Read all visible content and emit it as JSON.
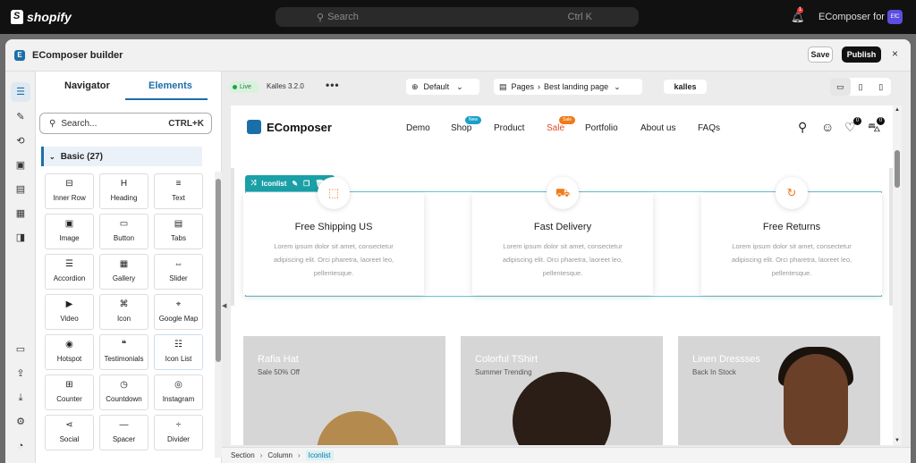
{
  "shopify": {
    "brand": "shopify",
    "search_placeholder": "Search",
    "search_shortcut": "Ctrl K",
    "notification_count": "1",
    "store_name": "EComposer for CS",
    "avatar_initials": "EfC"
  },
  "builder": {
    "title": "EComposer builder",
    "save_label": "Save",
    "publish_label": "Publish",
    "close_symbol": "×"
  },
  "rail_icons": [
    "layers-icon",
    "brush-icon",
    "history-icon",
    "clipboard-icon",
    "box-icon",
    "apps-icon",
    "page-icon",
    "folder-icon",
    "upload-icon",
    "download-icon",
    "settings-icon",
    "chat-icon"
  ],
  "panel": {
    "tab_navigator": "Navigator",
    "tab_elements": "Elements",
    "search_placeholder": "Search...",
    "search_shortcut": "CTRL+K",
    "group_title": "Basic (27)",
    "elements": [
      {
        "label": "Inner Row",
        "icon": "⊟"
      },
      {
        "label": "Heading",
        "icon": "H"
      },
      {
        "label": "Text",
        "icon": "≡"
      },
      {
        "label": "Image",
        "icon": "▣"
      },
      {
        "label": "Button",
        "icon": "▭"
      },
      {
        "label": "Tabs",
        "icon": "▤"
      },
      {
        "label": "Accordion",
        "icon": "☰"
      },
      {
        "label": "Gallery",
        "icon": "▦"
      },
      {
        "label": "Slider",
        "icon": "⇔"
      },
      {
        "label": "Video",
        "icon": "▶"
      },
      {
        "label": "Icon",
        "icon": "⌘"
      },
      {
        "label": "Google Map",
        "icon": "⌖"
      },
      {
        "label": "Hotspot",
        "icon": "◉"
      },
      {
        "label": "Testimonials",
        "icon": "❝"
      },
      {
        "label": "Icon List",
        "icon": "☷"
      },
      {
        "label": "Counter",
        "icon": "⊞"
      },
      {
        "label": "Countdown",
        "icon": "◷"
      },
      {
        "label": "Instagram",
        "icon": "◎"
      },
      {
        "label": "Social",
        "icon": "⋖"
      },
      {
        "label": "Spacer",
        "icon": "—"
      },
      {
        "label": "Divider",
        "icon": "÷"
      }
    ]
  },
  "toolbar": {
    "live_label": "Live",
    "theme_version": "Kalles 3.2.0",
    "more_symbol": "•••",
    "default_label": "Default",
    "pages_label": "Pages",
    "page_name": "Best landing page",
    "theme_badge": "kalles"
  },
  "site": {
    "logo_text": "EComposer",
    "menu": [
      "Demo",
      "Shop",
      "Product",
      "Sale",
      "Portfolio",
      "About us",
      "FAQs"
    ],
    "badge_new": "New",
    "badge_sale": "Sale",
    "wishlist_count": "0",
    "cart_count": "0"
  },
  "iconlist": {
    "tag_label": "Iconlist",
    "items": [
      {
        "title": "Free Shipping US",
        "desc": "Lorem ipsum dolor sit amet, consectetur adipiscing elit. Orci pharetra, laoreet leo, pellentesque.",
        "icon": "box-icon",
        "glyph": "⬚"
      },
      {
        "title": "Fast Delivery",
        "desc": "Lorem ipsum dolor sit amet, consectetur adipiscing elit. Orci pharetra, laoreet leo, pellentesque.",
        "icon": "truck-icon",
        "glyph": "⛟"
      },
      {
        "title": "Free Returns",
        "desc": "Lorem ipsum dolor sit amet, consectetur adipiscing elit. Orci pharetra, laoreet leo, pellentesque.",
        "icon": "refresh-icon",
        "glyph": "↻"
      }
    ]
  },
  "products": [
    {
      "title": "Rafia Hat",
      "subtitle": "Sale 50% Off"
    },
    {
      "title": "Colorful TShirt",
      "subtitle": "Summer Trending"
    },
    {
      "title": "Linen Dressses",
      "subtitle": "Back In Stock"
    }
  ],
  "breadcrumb": [
    "Section",
    "Column",
    "Iconlist"
  ],
  "colors": {
    "accent": "#1b6fa8",
    "selection": "#1aa0a6",
    "sale": "#e24a24",
    "icon_orange": "#f07a1a"
  }
}
